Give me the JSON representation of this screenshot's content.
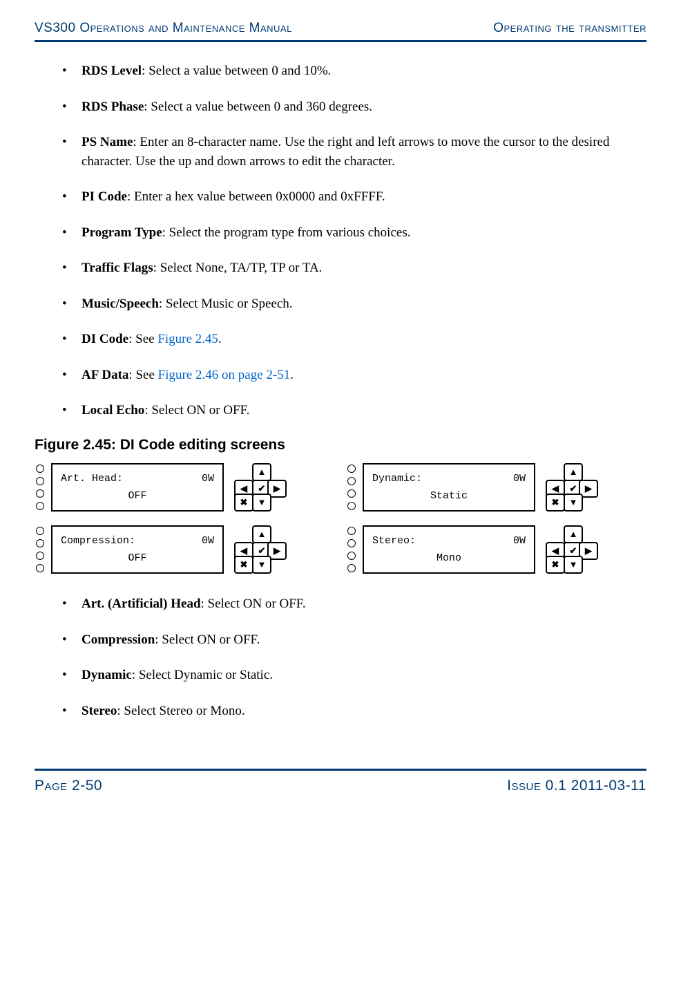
{
  "header": {
    "left": "VS300 Operations and Maintenance Manual",
    "right": "Operating the transmitter"
  },
  "bullets_top": [
    {
      "label": "RDS Level",
      "text": ": Select a value between 0 and 10%."
    },
    {
      "label": "RDS Phase",
      "text": ": Select a value between 0 and 360 degrees."
    },
    {
      "label": "PS Name",
      "text": ": Enter an 8-character name. Use the right and left arrows to move the cursor to the desired character. Use the up and down arrows to edit the character."
    },
    {
      "label": "PI Code",
      "text": ": Enter a hex value between 0x0000 and 0xFFFF."
    },
    {
      "label": "Program Type",
      "text": ": Select the program type from various choices."
    },
    {
      "label": "Traffic Flags",
      "text": ": Select None, TA/TP, TP or TA."
    },
    {
      "label": "Music/Speech",
      "text": ": Select Music or Speech."
    },
    {
      "label": "DI Code",
      "text_before": ": See ",
      "xref": "Figure 2.45",
      "text_after": "."
    },
    {
      "label": "AF Data",
      "text_before": ": See ",
      "xref": "Figure 2.46 on page 2-51",
      "text_after": "."
    },
    {
      "label": "Local Echo",
      "text": ": Select ON or OFF."
    }
  ],
  "figure": {
    "title": "Figure 2.45: DI Code editing screens",
    "screens": [
      {
        "label": "Art. Head:",
        "right": "0W",
        "value": "OFF"
      },
      {
        "label": "Dynamic:",
        "right": "0W",
        "value": "Static"
      },
      {
        "label": "Compression:",
        "right": "0W",
        "value": "OFF"
      },
      {
        "label": "Stereo:",
        "right": "0W",
        "value": "Mono"
      }
    ],
    "keys": {
      "up": "▲",
      "down": "▼",
      "left": "◀",
      "right": "▶",
      "ok": "✔",
      "cancel": "✖"
    }
  },
  "bullets_bottom": [
    {
      "label": "Art. (Artificial) Head",
      "text": ": Select ON or OFF."
    },
    {
      "label": "Compression",
      "text": ": Select ON or OFF."
    },
    {
      "label": "Dynamic",
      "text": ": Select Dynamic or Static."
    },
    {
      "label": "Stereo",
      "text": ": Select Stereo or Mono."
    }
  ],
  "footer": {
    "left": "Page 2-50",
    "right": "Issue 0.1  2011-03-11"
  }
}
